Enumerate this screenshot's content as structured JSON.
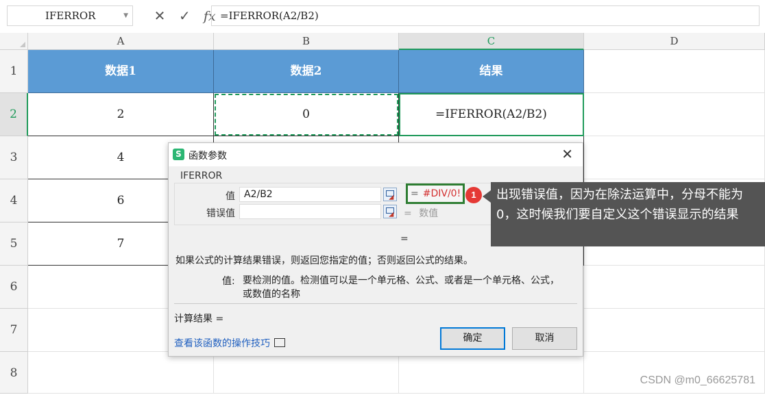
{
  "formula_bar": {
    "name_box": "IFERROR",
    "cancel_glyph": "✕",
    "enter_glyph": "✓",
    "fx_glyph": "fx",
    "formula": "=IFERROR(A2/B2)"
  },
  "sheet": {
    "columns": [
      "A",
      "B",
      "C",
      "D"
    ],
    "selected_column": "C",
    "rows": [
      "1",
      "2",
      "3",
      "4",
      "5",
      "6",
      "7",
      "8"
    ],
    "selected_row": "2",
    "header_row": [
      "数据1",
      "数据2",
      "结果"
    ],
    "data": [
      [
        "2",
        "0",
        "=IFERROR(A2/B2)"
      ],
      [
        "4",
        "",
        ""
      ],
      [
        "6",
        "",
        ""
      ],
      [
        "7",
        "",
        ""
      ]
    ],
    "header_color": "#5b9bd5",
    "selection_color": "#1f9a5a"
  },
  "dialog": {
    "logo": "S",
    "title": "函数参数",
    "close": "✕",
    "function_name": "IFERROR",
    "args": [
      {
        "label": "值",
        "value": "A2/B2",
        "result_eq": "=",
        "result": "#DIV/0!"
      },
      {
        "label": "错误值",
        "value": "",
        "result_eq": "=",
        "result": "数值"
      }
    ],
    "overall_eq": "=",
    "description": "如果公式的计算结果错误，则返回您指定的值；否则返回公式的结果。",
    "arg_desc_label": "值:",
    "arg_desc": "要检测的值。检测值可以是一个单元格、公式、或者是一个单元格、公式，或数值的名称",
    "calc_result": "计算结果 =",
    "help_link": "查看该函数的操作技巧",
    "ok": "确定",
    "cancel": "取消",
    "error_color": "#d32f2f",
    "highlight_color": "#2e7d32"
  },
  "annotation": {
    "badge": "1",
    "text": "出现错误值，因为在除法运算中，分母不能为0，这时候我们要自定义这个错误显示的结果"
  },
  "watermark": "CSDN @m0_66625781"
}
